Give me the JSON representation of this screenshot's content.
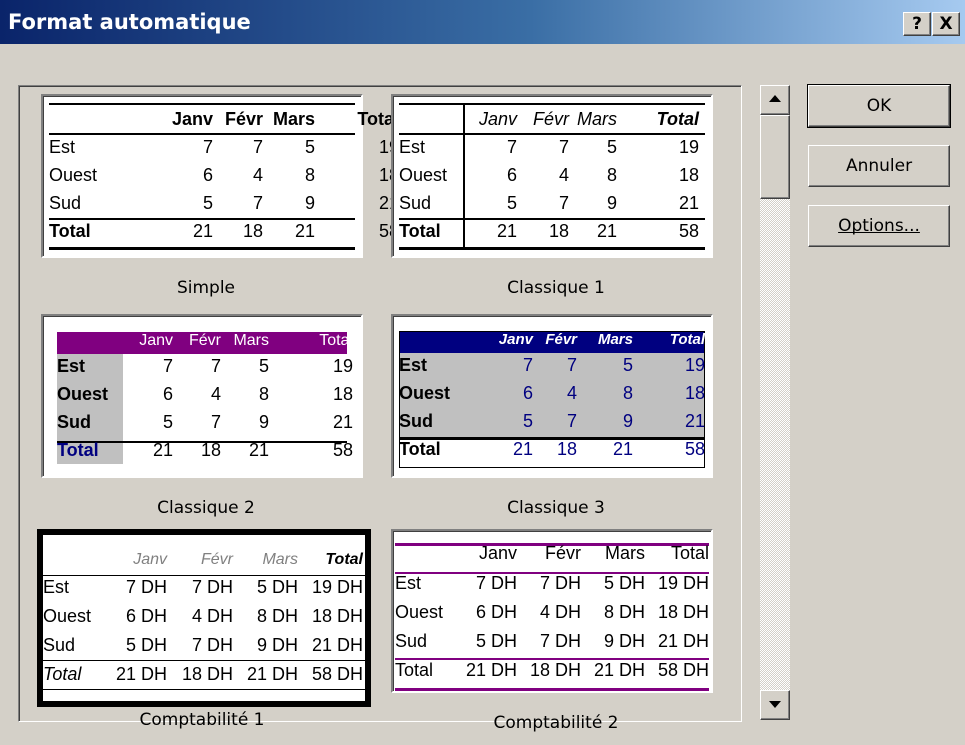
{
  "window": {
    "title": "Format automatique",
    "help": "?",
    "close": "X"
  },
  "buttons": {
    "ok": "OK",
    "cancel": "Annuler",
    "options": "Options..."
  },
  "months": [
    "Janv",
    "Févr",
    "Mars",
    "Total"
  ],
  "rows": [
    {
      "label": "Est",
      "values": [
        "7",
        "7",
        "5",
        "19"
      ]
    },
    {
      "label": "Ouest",
      "values": [
        "6",
        "4",
        "8",
        "18"
      ]
    },
    {
      "label": "Sud",
      "values": [
        "5",
        "7",
        "9",
        "21"
      ]
    },
    {
      "label": "Total",
      "values": [
        "21",
        "18",
        "21",
        "58"
      ]
    }
  ],
  "rows_dh": [
    {
      "label": "Est",
      "values": [
        "7 DH",
        "7 DH",
        "5 DH",
        "19 DH"
      ]
    },
    {
      "label": "Ouest",
      "values": [
        "6 DH",
        "4 DH",
        "8 DH",
        "18 DH"
      ]
    },
    {
      "label": "Sud",
      "values": [
        "5 DH",
        "7 DH",
        "9 DH",
        "21 DH"
      ]
    },
    {
      "label": "Total",
      "values": [
        "21 DH",
        "18 DH",
        "21 DH",
        "58 DH"
      ]
    }
  ],
  "formats": [
    {
      "name": "Simple"
    },
    {
      "name": "Classique 1"
    },
    {
      "name": "Classique 2"
    },
    {
      "name": "Classique 3"
    },
    {
      "name": "Comptabilité 1"
    },
    {
      "name": "Comptabilité 2"
    }
  ],
  "colors": {
    "purple": "#800080",
    "navy": "#000080",
    "gray": "#c0c0c0",
    "title_start": "#0a246a",
    "title_end": "#a6caf0"
  }
}
